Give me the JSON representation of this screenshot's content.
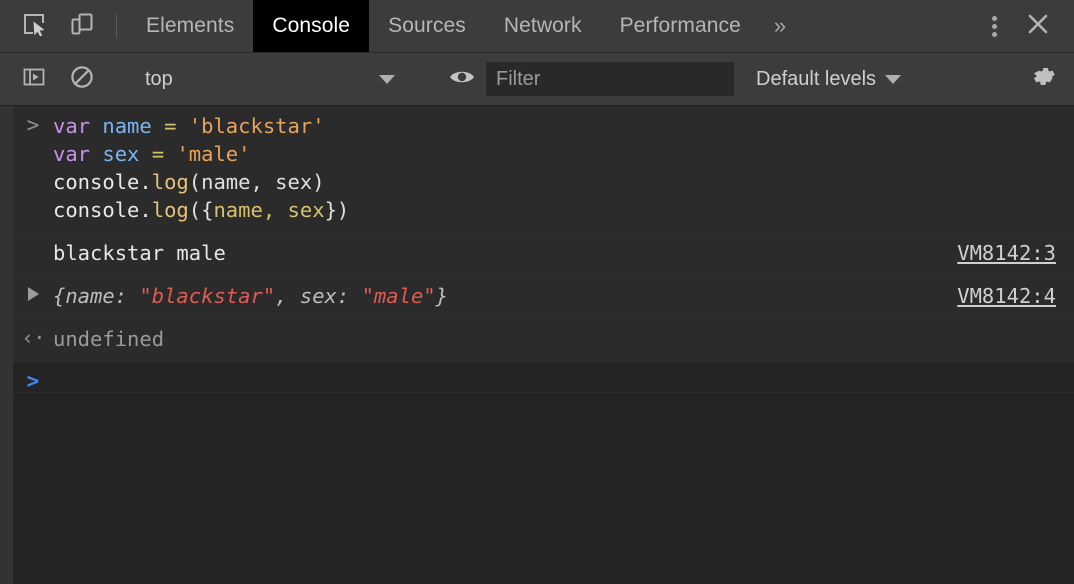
{
  "tabbar": {
    "inspect_icon": "inspect-element-icon",
    "device_icon": "device-toolbar-icon",
    "tabs": [
      {
        "label": "Elements",
        "selected": false
      },
      {
        "label": "Console",
        "selected": true
      },
      {
        "label": "Sources",
        "selected": false
      },
      {
        "label": "Network",
        "selected": false
      },
      {
        "label": "Performance",
        "selected": false
      }
    ],
    "more_tabs_label": "»",
    "menu_icon": "kebab-menu-icon",
    "close_icon": "close-icon"
  },
  "filterbar": {
    "sidebar_icon": "console-sidebar-icon",
    "clear_icon": "clear-console-icon",
    "context_value": "top",
    "eye_icon": "live-expression-icon",
    "filter_placeholder": "Filter",
    "levels_value": "Default levels",
    "settings_icon": "settings-gear-icon"
  },
  "console": {
    "input_prompt": ">",
    "input_lines": [
      {
        "tokens": [
          {
            "text": "var",
            "cls": "t-kw"
          },
          {
            "text": " ",
            "cls": "t-punc"
          },
          {
            "text": "name",
            "cls": "t-var"
          },
          {
            "text": " ",
            "cls": "t-punc"
          },
          {
            "text": "=",
            "cls": "t-op"
          },
          {
            "text": " ",
            "cls": "t-punc"
          },
          {
            "text": "'blackstar'",
            "cls": "t-str"
          }
        ]
      },
      {
        "tokens": [
          {
            "text": "var",
            "cls": "t-kw"
          },
          {
            "text": " ",
            "cls": "t-punc"
          },
          {
            "text": "sex",
            "cls": "t-var"
          },
          {
            "text": " ",
            "cls": "t-punc"
          },
          {
            "text": "=",
            "cls": "t-op"
          },
          {
            "text": " ",
            "cls": "t-punc"
          },
          {
            "text": "'male'",
            "cls": "t-str"
          }
        ]
      },
      {
        "tokens": [
          {
            "text": "console.",
            "cls": "t-obj"
          },
          {
            "text": "log",
            "cls": "t-fn"
          },
          {
            "text": "(name, sex)",
            "cls": "t-punc"
          }
        ]
      },
      {
        "tokens": [
          {
            "text": "console.",
            "cls": "t-obj"
          },
          {
            "text": "log",
            "cls": "t-fn"
          },
          {
            "text": "({",
            "cls": "t-punc"
          },
          {
            "text": "name, sex",
            "cls": "t-prop"
          },
          {
            "text": "})",
            "cls": "t-punc"
          }
        ]
      }
    ],
    "output_rows": [
      {
        "kind": "log",
        "marker": "none",
        "text": "blackstar male",
        "link": "VM8142:3"
      },
      {
        "kind": "object",
        "marker": "triangle",
        "link": "VM8142:4",
        "segments": [
          {
            "text": "{name: ",
            "kind": "key"
          },
          {
            "text": "\"blackstar\"",
            "kind": "string"
          },
          {
            "text": ", sex: ",
            "kind": "key"
          },
          {
            "text": "\"male\"",
            "kind": "string"
          },
          {
            "text": "}",
            "kind": "key"
          }
        ]
      },
      {
        "kind": "result",
        "marker": "return",
        "return_glyph": "‹·",
        "text": "undefined",
        "link": ""
      }
    ],
    "prompt_glyph": ">"
  },
  "colors": {
    "toolbar_bg": "#3c3c3c",
    "console_bg": "#242424",
    "row_bg": "#2b2b2b",
    "selected_tab_bg": "#000000",
    "accent_blue": "#4285f4",
    "string_red": "#e05a52",
    "string_orange": "#e8a35c",
    "keyword_purple": "#c792ea",
    "variable_blue": "#79b6f2"
  }
}
